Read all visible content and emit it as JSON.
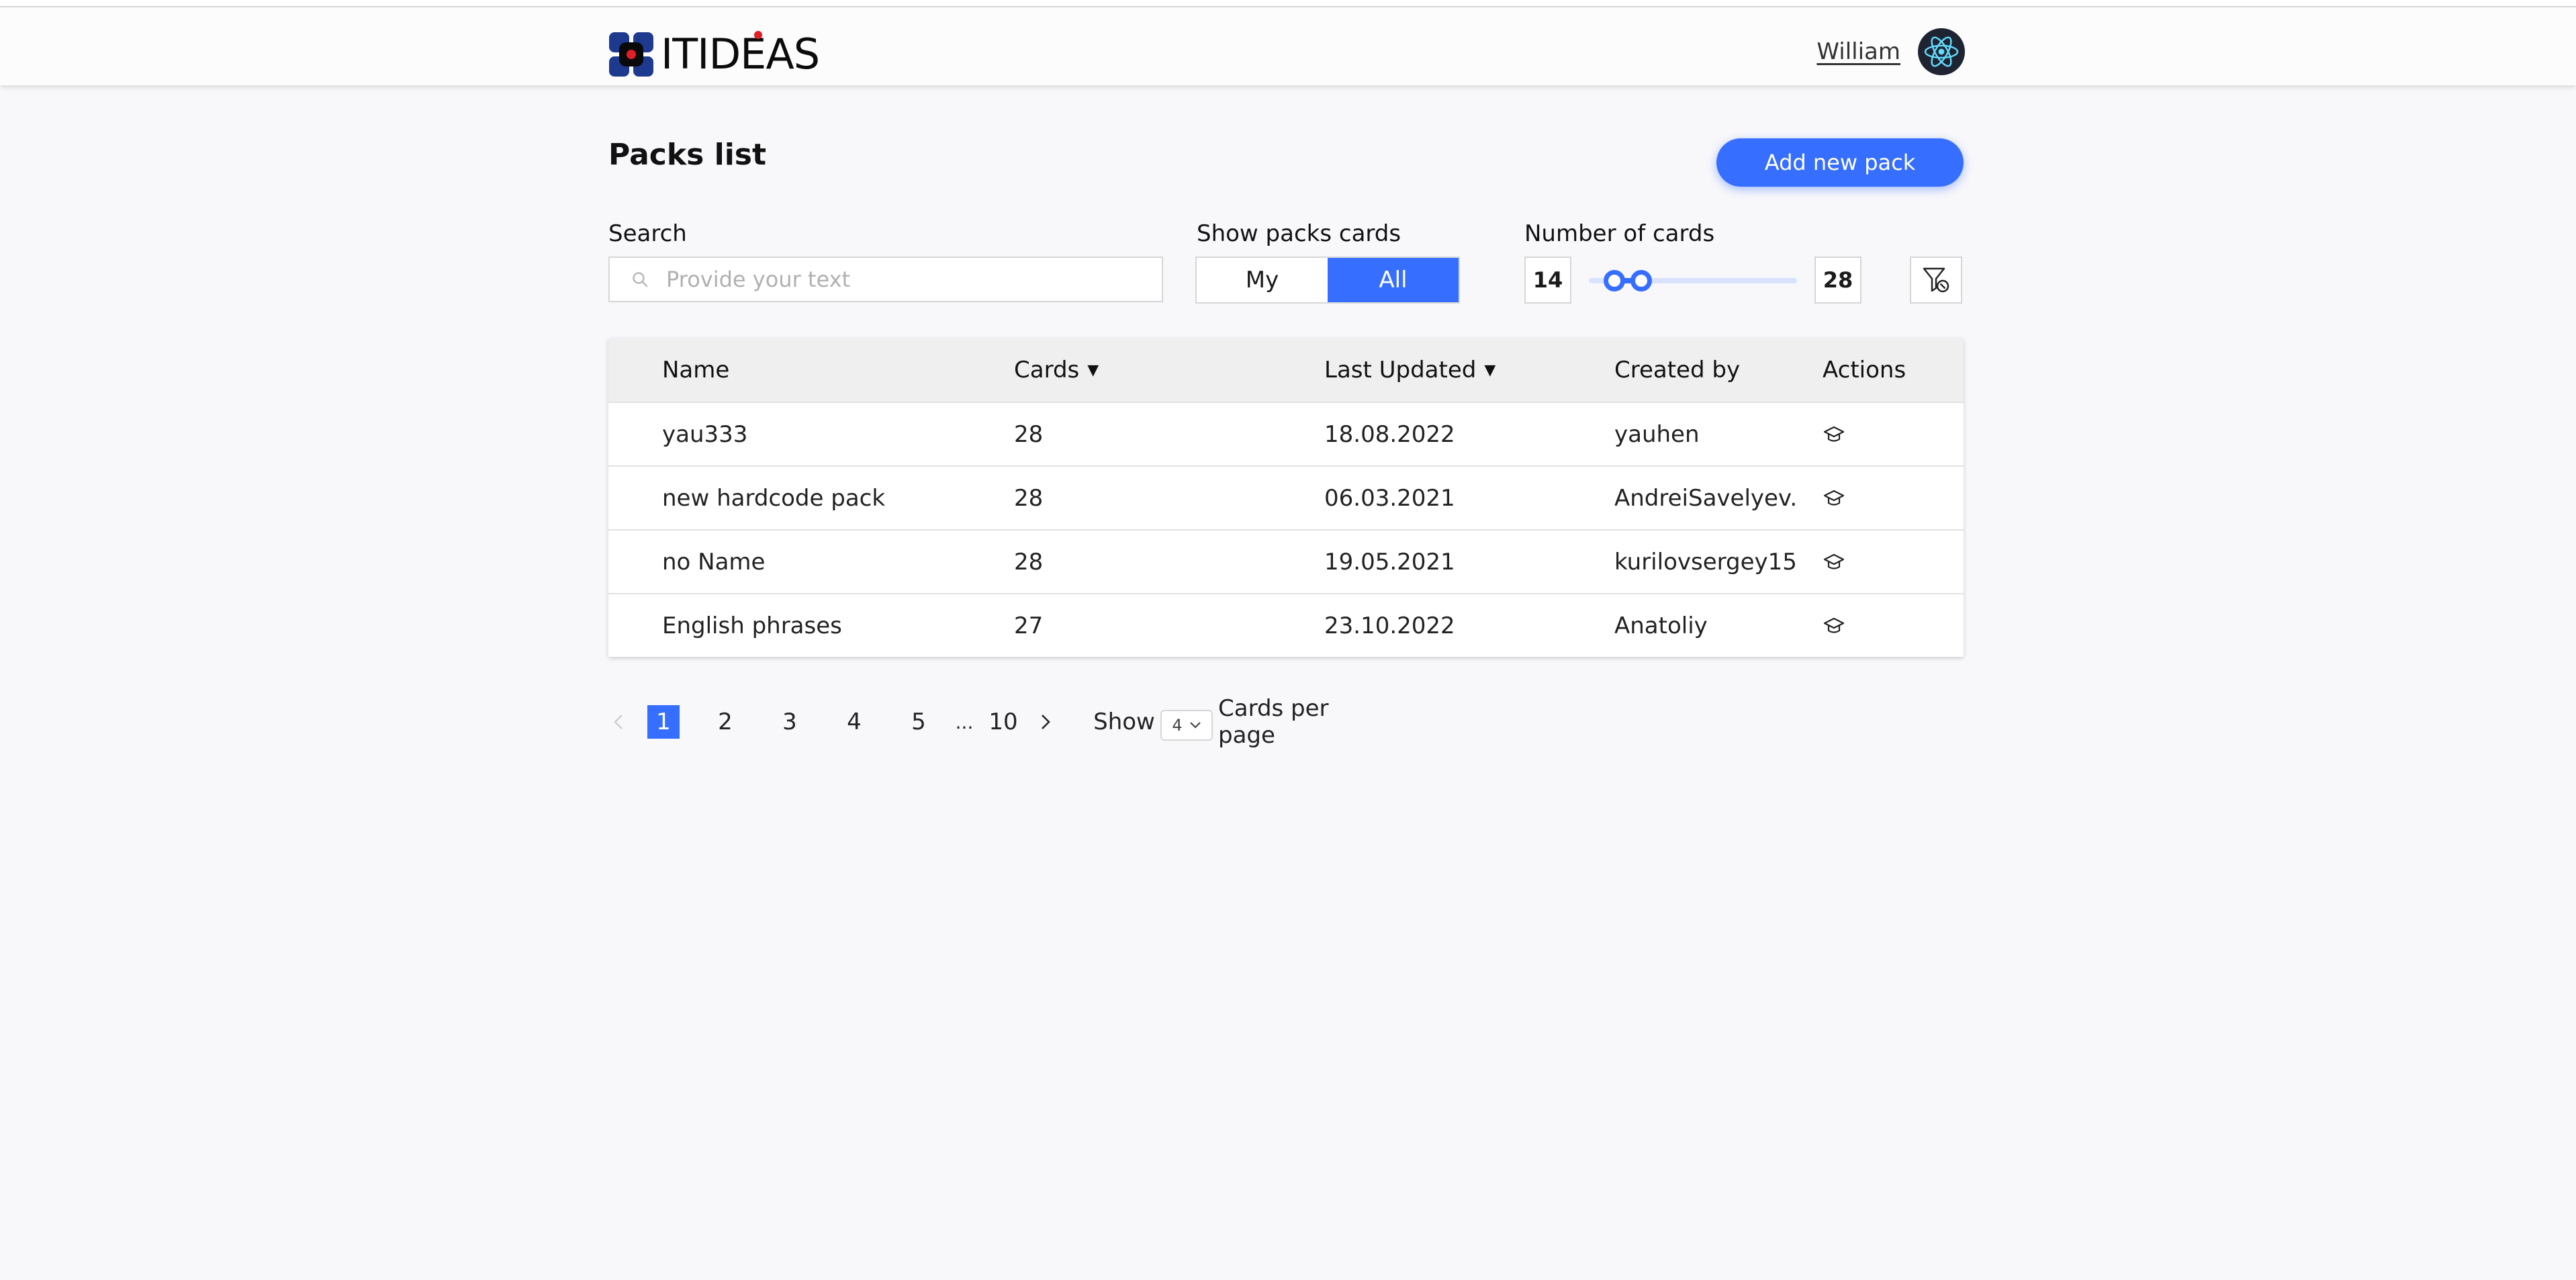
{
  "header": {
    "logo_text": "ITIDEAS",
    "user_name": "William"
  },
  "page": {
    "title": "Packs list",
    "add_button": "Add new pack"
  },
  "filters": {
    "search_label": "Search",
    "search_placeholder": "Provide your text",
    "search_value": "",
    "show_label": "Show packs cards",
    "show_options": [
      "My",
      "All"
    ],
    "show_selected": "All",
    "number_label": "Number of cards",
    "min_value": "14",
    "max_value": "28"
  },
  "table": {
    "columns": {
      "name": "Name",
      "cards": "Cards",
      "updated": "Last Updated",
      "created_by": "Created by",
      "actions": "Actions"
    },
    "rows": [
      {
        "name": "yau333",
        "cards": "28",
        "updated": "18.08.2022",
        "created_by": "yauhen"
      },
      {
        "name": "new hardcode pack",
        "cards": "28",
        "updated": "06.03.2021",
        "created_by": "AndreiSavelyev..."
      },
      {
        "name": "no Name",
        "cards": "28",
        "updated": "19.05.2021",
        "created_by": "kurilovsergey15..."
      },
      {
        "name": "English phrases",
        "cards": "27",
        "updated": "23.10.2022",
        "created_by": "Anatoliy"
      }
    ]
  },
  "pagination": {
    "pages": [
      "1",
      "2",
      "3",
      "4",
      "5"
    ],
    "ellipsis": "...",
    "last_page": "10",
    "current": "1",
    "show_label": "Show",
    "per_page_value": "4",
    "per_page_label": "Cards per page"
  },
  "colors": {
    "accent": "#366eff",
    "background": "#f8f8fb"
  },
  "icons": [
    "logo-icon",
    "react-avatar-icon",
    "search-icon",
    "filter-reset-icon",
    "learn-icon",
    "chevron-left-icon",
    "chevron-right-icon",
    "chevron-down-icon",
    "sort-down-icon"
  ]
}
